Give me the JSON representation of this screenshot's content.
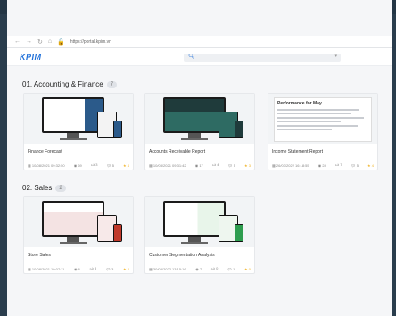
{
  "browser": {
    "url": "https://portal.kpim.vn"
  },
  "app": {
    "logo": "KPIM"
  },
  "sections": [
    {
      "title": "01. Accounting & Finance",
      "count": "7"
    },
    {
      "title": "02. Sales",
      "count": "2"
    }
  ],
  "cards": [
    {
      "title": "Finance Forecast",
      "date": "10/08/2021 09:32:50",
      "views": "69",
      "likes": "3",
      "comments": "5",
      "stars": "4"
    },
    {
      "title": "Accounts Receivable Report",
      "date": "10/08/2021 09:31:42",
      "views": "17",
      "likes": "4",
      "comments": "5",
      "stars": "3"
    },
    {
      "title": "Income Statement Report",
      "date": "26/03/2022 16:18:55",
      "views": "24",
      "likes": "7",
      "comments": "5",
      "stars": "4"
    },
    {
      "title": "Store Sales",
      "date": "10/08/2021 10:07:11",
      "views": "6",
      "likes": "3",
      "comments": "3",
      "stars": "4"
    },
    {
      "title": "Customer Segmentation Analysis",
      "date": "30/03/2022 13:15:16",
      "views": "7",
      "likes": "0",
      "comments": "1",
      "stars": "0"
    }
  ],
  "doc_preview": {
    "heading": "Performance for May"
  },
  "colors": {
    "accent": "#1e6fd9",
    "star": "#f0b429"
  }
}
